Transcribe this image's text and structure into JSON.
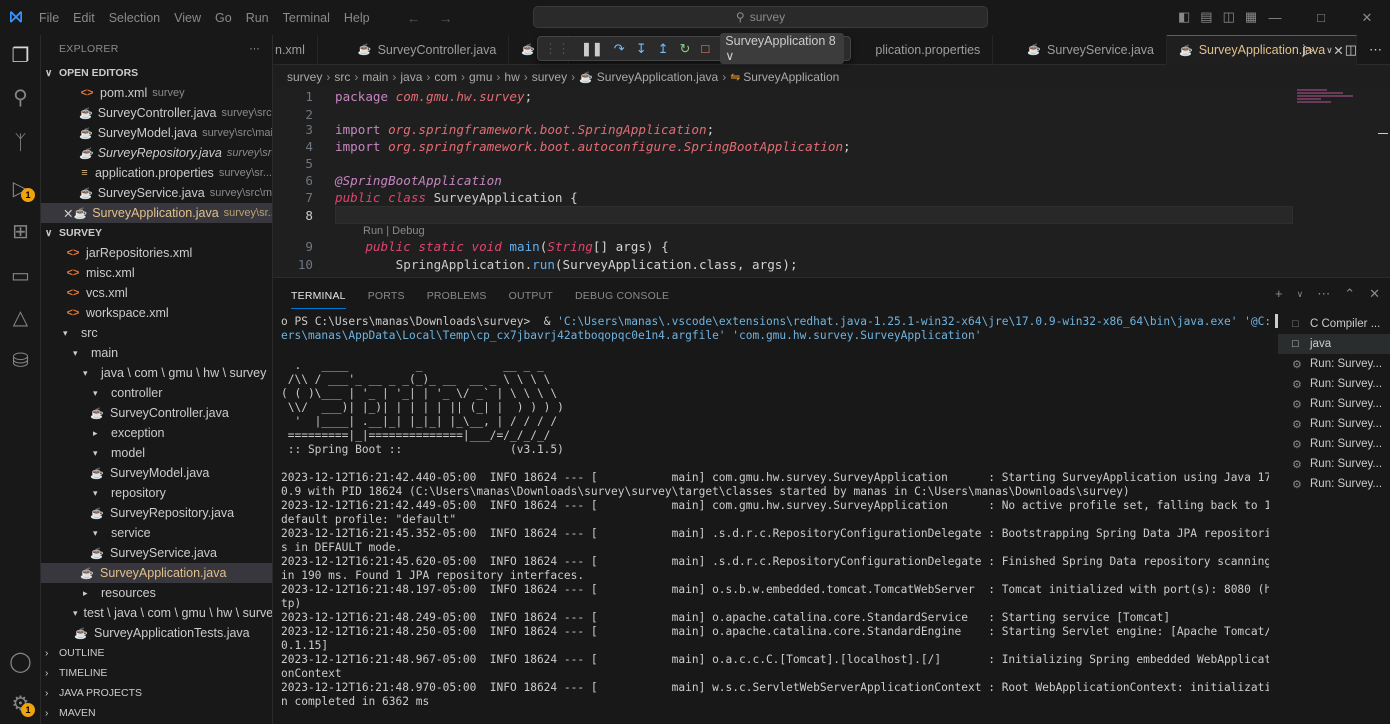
{
  "menu": [
    "File",
    "Edit",
    "Selection",
    "View",
    "Go",
    "Run",
    "Terminal",
    "Help"
  ],
  "search": "survey",
  "explorer": {
    "title": "EXPLORER",
    "open_editors_label": "OPEN EDITORS",
    "open_editors": [
      {
        "name": "pom.xml",
        "desc": "survey",
        "type": "xml"
      },
      {
        "name": "SurveyController.java",
        "desc": "survey\\src...",
        "type": "java"
      },
      {
        "name": "SurveyModel.java",
        "desc": "survey\\src\\mai...",
        "type": "java"
      },
      {
        "name": "SurveyRepository.java",
        "desc": "survey\\src...",
        "type": "java"
      },
      {
        "name": "application.properties",
        "desc": "survey\\sr...",
        "type": "props"
      },
      {
        "name": "SurveyService.java",
        "desc": "survey\\src\\m...",
        "type": "java"
      },
      {
        "name": "SurveyApplication.java",
        "desc": "survey\\sr...",
        "type": "java"
      }
    ],
    "project_label": "SURVEY",
    "tree": {
      "jar": "jarRepositories.xml",
      "misc": "misc.xml",
      "vcs": "vcs.xml",
      "workspace": "workspace.xml",
      "src": "src",
      "main": "main",
      "pkg": "java \\ com \\ gmu \\ hw \\ survey",
      "controller": "controller",
      "controller_file": "SurveyController.java",
      "exception": "exception",
      "model": "model",
      "model_file": "SurveyModel.java",
      "repository": "repository",
      "repository_file": "SurveyRepository.java",
      "service": "service",
      "service_file": "SurveyService.java",
      "app_file": "SurveyApplication.java",
      "resources": "resources",
      "test": "test \\ java \\ com \\ gmu \\ hw \\ survey",
      "test_file": "SurveyApplicationTests.java"
    },
    "outline": "OUTLINE",
    "timeline": "TIMELINE",
    "java_projects": "JAVA PROJECTS",
    "maven": "MAVEN"
  },
  "tabs": [
    {
      "label": "n.xml"
    },
    {
      "label": "SurveyController.java"
    },
    {
      "label": "Su"
    },
    {
      "label": "plication.properties"
    },
    {
      "label": "SurveyService.java"
    },
    {
      "label": "SurveyApplication.java"
    }
  ],
  "debug": {
    "config": "SurveyApplication 8"
  },
  "breadcrumb": [
    "survey",
    "src",
    "main",
    "java",
    "com",
    "gmu",
    "hw",
    "survey",
    "SurveyApplication.java",
    "SurveyApplication"
  ],
  "editor": {
    "line_numbers": [
      "1",
      "2",
      "3",
      "4",
      "5",
      "6",
      "7",
      "8",
      "9",
      "10"
    ],
    "codelens": "Run | Debug",
    "l1_kw": "package",
    "l1_pkg": "com.gmu.hw.survey",
    "l3_kw": "import",
    "l3_pkg": "org.springframework.boot.",
    "l3_cls": "SpringApplication",
    "l4_kw": "import",
    "l4_pkg": "org.springframework.boot.autoconfigure.",
    "l4_cls": "SpringBootApplication",
    "l6_ann": "@SpringBootApplication",
    "l7_kw": "public class",
    "l7_cls": "SurveyApplication",
    "l9_kw": "public static void",
    "l9_fn": "main",
    "l9_type": "String",
    "l9_arg": "[] args) {",
    "l10_cls": "SpringApplication",
    "l10_fn": "run",
    "l10_rest": "(SurveyApplication.class, args);"
  },
  "panel": {
    "tabs": [
      "TERMINAL",
      "PORTS",
      "PROBLEMS",
      "OUTPUT",
      "DEBUG CONSOLE"
    ],
    "terminals": [
      "C Compiler ...",
      "java",
      "Run: Survey...",
      "Run: Survey...",
      "Run: Survey...",
      "Run: Survey...",
      "Run: Survey...",
      "Run: Survey...",
      "Run: Survey..."
    ]
  },
  "terminal": {
    "cmd_prompt": "PS C:\\Users\\manas\\Downloads\\survey>  & ",
    "cmd_str1": "'C:\\Users\\manas\\.vscode\\extensions\\redhat.java-1.25.1-win32-x64\\jre\\17.0.9-win32-x86_64\\bin\\java.exe' '@C:\\Us",
    "cmd_str2": "ers\\manas\\AppData\\Local\\Temp\\cp_cx7jbavrj42atboqopqc0e1n4.argfile' 'com.gmu.hw.survey.SurveyApplication'",
    "banner": [
      "  .   ____          _            __ _ _",
      " /\\\\ / ___'_ __ _ _(_)_ __  __ _ \\ \\ \\ \\",
      "( ( )\\___ | '_ | '_| | '_ \\/ _` | \\ \\ \\ \\",
      " \\\\/  ___)| |_)| | | | | || (_| |  ) ) ) )",
      "  '  |____| .__|_| |_|_| |_\\__, | / / / /",
      " =========|_|==============|___/=/_/_/_/",
      " :: Spring Boot ::                (v3.1.5)"
    ],
    "log": [
      "2023-12-12T16:21:42.440-05:00  INFO 18624 --- [           main] com.gmu.hw.survey.SurveyApplication      : Starting SurveyApplication using Java 17.",
      "0.9 with PID 18624 (C:\\Users\\manas\\Downloads\\survey\\survey\\target\\classes started by manas in C:\\Users\\manas\\Downloads\\survey)",
      "2023-12-12T16:21:42.449-05:00  INFO 18624 --- [           main] com.gmu.hw.survey.SurveyApplication      : No active profile set, falling back to 1",
      "default profile: \"default\"",
      "2023-12-12T16:21:45.352-05:00  INFO 18624 --- [           main] .s.d.r.c.RepositoryConfigurationDelegate : Bootstrapping Spring Data JPA repositorie",
      "s in DEFAULT mode.",
      "2023-12-12T16:21:45.620-05:00  INFO 18624 --- [           main] .s.d.r.c.RepositoryConfigurationDelegate : Finished Spring Data repository scanning",
      "in 190 ms. Found 1 JPA repository interfaces.",
      "2023-12-12T16:21:48.197-05:00  INFO 18624 --- [           main] o.s.b.w.embedded.tomcat.TomcatWebServer  : Tomcat initialized with port(s): 8080 (ht",
      "tp)",
      "2023-12-12T16:21:48.249-05:00  INFO 18624 --- [           main] o.apache.catalina.core.StandardService   : Starting service [Tomcat]",
      "2023-12-12T16:21:48.250-05:00  INFO 18624 --- [           main] o.apache.catalina.core.StandardEngine    : Starting Servlet engine: [Apache Tomcat/1",
      "0.1.15]",
      "2023-12-12T16:21:48.967-05:00  INFO 18624 --- [           main] o.a.c.c.C.[Tomcat].[localhost].[/]       : Initializing Spring embedded WebApplicati",
      "onContext",
      "2023-12-12T16:21:48.970-05:00  INFO 18624 --- [           main] w.s.c.ServletWebServerApplicationContext : Root WebApplicationContext: initializatio",
      "n completed in 6362 ms"
    ]
  }
}
